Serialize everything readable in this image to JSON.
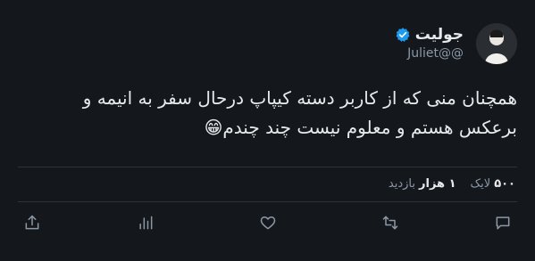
{
  "author": {
    "display_name": "جولیت",
    "handle": "Juliet@@",
    "verified": true,
    "avatar_icon": "avatar-photo",
    "verified_color": "#1d9bf0"
  },
  "tweet": {
    "lines": [
      "همچنان منی که از کاربر دسته کیپاپ درحال سفر به انیمه و",
      "برعکس هستم و معلوم نیست چند چندم😁"
    ]
  },
  "stats": {
    "likes_count": "۵۰۰",
    "likes_label": "لایک",
    "views_count": "۱ هزار",
    "views_label": "بازدید"
  },
  "actions": [
    {
      "name": "reply",
      "icon": "reply-icon"
    },
    {
      "name": "retweet",
      "icon": "retweet-icon"
    },
    {
      "name": "like",
      "icon": "heart-icon"
    },
    {
      "name": "views",
      "icon": "views-icon"
    },
    {
      "name": "share",
      "icon": "share-icon"
    }
  ],
  "colors": {
    "background": "#14171c",
    "text": "#e7e9ea",
    "muted": "#8b98a5",
    "divider": "#2f3336"
  }
}
